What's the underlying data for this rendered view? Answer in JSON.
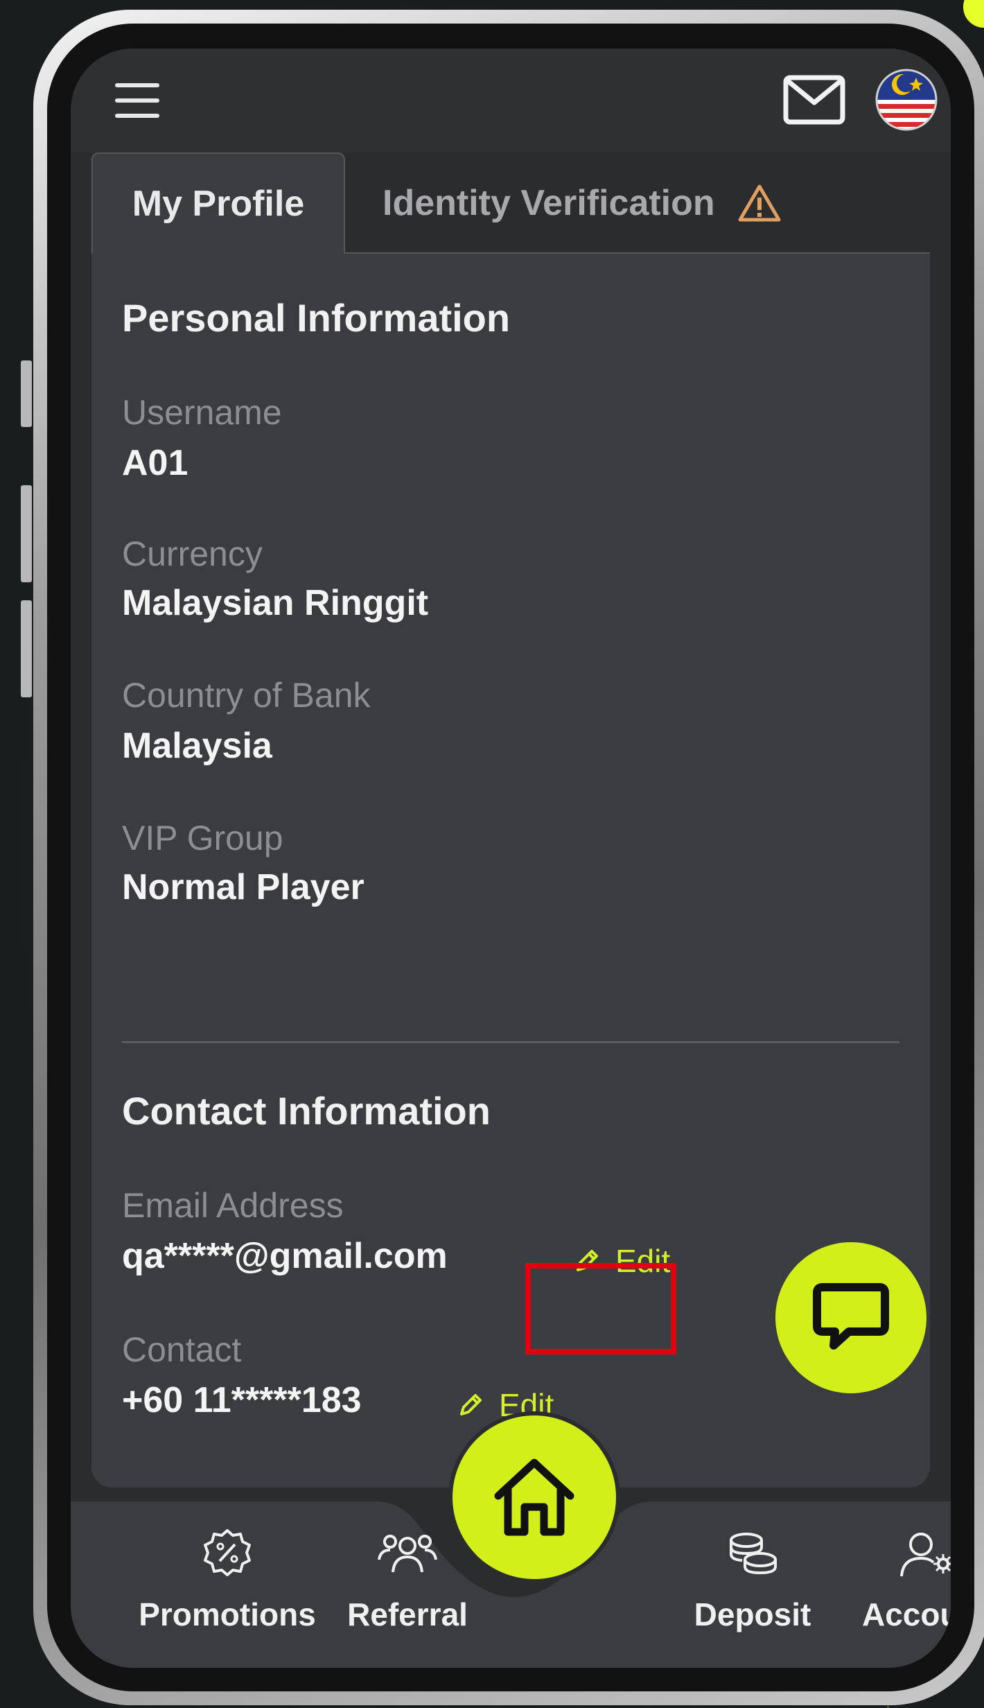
{
  "header": {
    "menu_icon": "hamburger-icon",
    "mail_icon": "mail-icon",
    "flag_icon": "malaysia-flag-icon"
  },
  "tabs": [
    {
      "label": "My Profile",
      "active": true
    },
    {
      "label": "Identity Verification",
      "active": false,
      "icon": "warning-icon"
    }
  ],
  "personal": {
    "title": "Personal Information",
    "fields": [
      {
        "label": "Username",
        "value": "A01"
      },
      {
        "label": "Currency",
        "value": "Malaysian Ringgit"
      },
      {
        "label": "Country of Bank",
        "value": "Malaysia"
      },
      {
        "label": "VIP Group",
        "value": "Normal Player"
      }
    ]
  },
  "contact": {
    "title": "Contact Information",
    "email_label": "Email Address",
    "email_value": "qa*****@gmail.com",
    "contact_label": "Contact",
    "contact_value": "+60 11*****183",
    "edit_label": "Edit"
  },
  "nav": {
    "items": [
      {
        "label": "Promotions",
        "icon": "promotion-badge-icon"
      },
      {
        "label": "Referral",
        "icon": "referral-users-icon"
      },
      {
        "label": "Deposit",
        "icon": "coins-icon"
      },
      {
        "label": "Account",
        "icon": "account-settings-icon"
      }
    ],
    "home_icon": "home-icon",
    "chat_icon": "chat-icon"
  },
  "colors": {
    "accent": "#d2ef1a",
    "highlight": "#e00010",
    "warning": "#e0a060"
  }
}
